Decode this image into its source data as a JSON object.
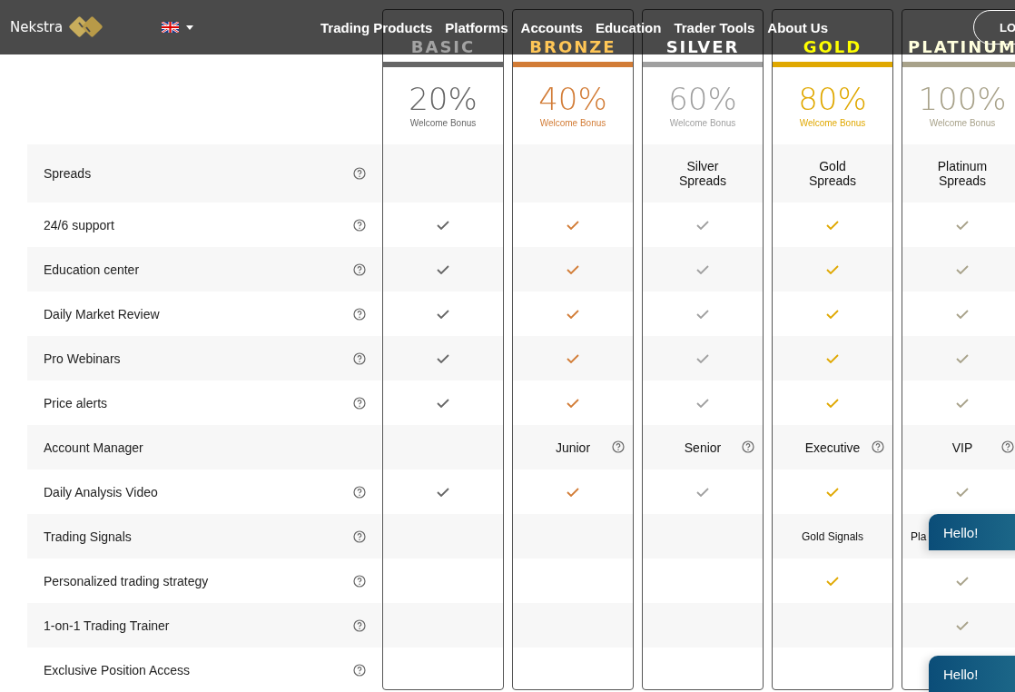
{
  "header": {
    "logo": "Nekstra",
    "nav": [
      "Trading Products",
      "Platforms",
      "Accounts",
      "Education",
      "Trader Tools",
      "About Us"
    ],
    "login": "LO"
  },
  "features": [
    {
      "label": "Spreads",
      "help": true
    },
    {
      "label": "24/6 support",
      "help": true
    },
    {
      "label": "Education center",
      "help": true
    },
    {
      "label": "Daily Market Review",
      "help": true
    },
    {
      "label": "Pro Webinars",
      "help": true
    },
    {
      "label": "Price alerts",
      "help": true
    },
    {
      "label": "Account Manager",
      "help": false
    },
    {
      "label": "Daily Analysis Video",
      "help": true
    },
    {
      "label": "Trading Signals",
      "help": true
    },
    {
      "label": "Personalized trading strategy",
      "help": true
    },
    {
      "label": "1-on-1 Trading Trainer",
      "help": true
    },
    {
      "label": "Exclusive Position Access",
      "help": true
    }
  ],
  "plans": [
    {
      "name": "BASIC",
      "color": "#666666",
      "bonus": "20%",
      "bonus_label": "Welcome Bonus",
      "cells": [
        {
          "kind": "empty"
        },
        {
          "kind": "check"
        },
        {
          "kind": "check"
        },
        {
          "kind": "check"
        },
        {
          "kind": "check"
        },
        {
          "kind": "check"
        },
        {
          "kind": "empty"
        },
        {
          "kind": "check"
        },
        {
          "kind": "empty"
        },
        {
          "kind": "empty"
        },
        {
          "kind": "empty"
        },
        {
          "kind": "empty"
        }
      ]
    },
    {
      "name": "BRONZE",
      "color": "#d27c36",
      "bonus": "40%",
      "bonus_label": "Welcome Bonus",
      "cells": [
        {
          "kind": "empty"
        },
        {
          "kind": "check"
        },
        {
          "kind": "check"
        },
        {
          "kind": "check"
        },
        {
          "kind": "check"
        },
        {
          "kind": "check"
        },
        {
          "kind": "text_help",
          "text": "Junior"
        },
        {
          "kind": "check"
        },
        {
          "kind": "empty"
        },
        {
          "kind": "empty"
        },
        {
          "kind": "empty"
        },
        {
          "kind": "empty"
        }
      ]
    },
    {
      "name": "SILVER",
      "color": "#a0a0a0",
      "bonus": "60%",
      "bonus_label": "Welcome Bonus",
      "cells": [
        {
          "kind": "text",
          "text": "Silver Spreads"
        },
        {
          "kind": "check"
        },
        {
          "kind": "check"
        },
        {
          "kind": "check"
        },
        {
          "kind": "check"
        },
        {
          "kind": "check"
        },
        {
          "kind": "text_help",
          "text": "Senior"
        },
        {
          "kind": "check"
        },
        {
          "kind": "empty"
        },
        {
          "kind": "empty"
        },
        {
          "kind": "empty"
        },
        {
          "kind": "empty"
        }
      ]
    },
    {
      "name": "GOLD",
      "color": "#e0a800",
      "bonus": "80%",
      "bonus_label": "Welcome Bonus",
      "cells": [
        {
          "kind": "text",
          "text": "Gold Spreads"
        },
        {
          "kind": "check"
        },
        {
          "kind": "check"
        },
        {
          "kind": "check"
        },
        {
          "kind": "check"
        },
        {
          "kind": "check"
        },
        {
          "kind": "text_help",
          "text": "Executive"
        },
        {
          "kind": "check"
        },
        {
          "kind": "text_small",
          "text": "Gold Signals"
        },
        {
          "kind": "check"
        },
        {
          "kind": "empty"
        },
        {
          "kind": "empty"
        }
      ]
    },
    {
      "name": "PLATINUM",
      "color": "#a8a28a",
      "bonus": "100%",
      "bonus_label": "Welcome Bonus",
      "cells": [
        {
          "kind": "text",
          "text": "Platinum Spreads"
        },
        {
          "kind": "check"
        },
        {
          "kind": "check"
        },
        {
          "kind": "check"
        },
        {
          "kind": "check"
        },
        {
          "kind": "check"
        },
        {
          "kind": "text_help",
          "text": "VIP"
        },
        {
          "kind": "check"
        },
        {
          "kind": "text_start",
          "text": "Pla"
        },
        {
          "kind": "check"
        },
        {
          "kind": "check"
        },
        {
          "kind": "empty"
        }
      ]
    }
  ],
  "chat": [
    {
      "label": "Hello!"
    },
    {
      "label": "Hello!"
    }
  ]
}
